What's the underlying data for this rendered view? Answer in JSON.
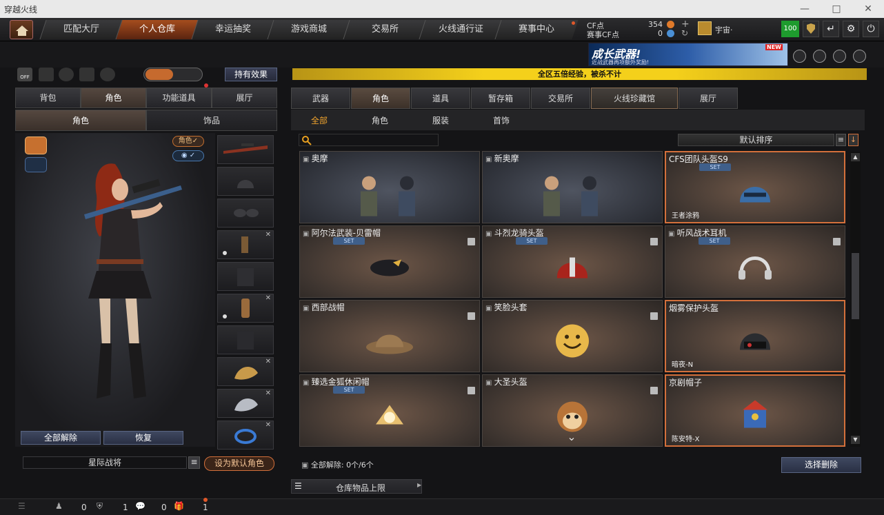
{
  "window": {
    "title": "穿越火线"
  },
  "nav": {
    "tabs": [
      {
        "label": "匹配大厅"
      },
      {
        "label": "个人仓库"
      },
      {
        "label": "幸运抽奖"
      },
      {
        "label": "游戏商城"
      },
      {
        "label": "交易所"
      },
      {
        "label": "火线通行证"
      },
      {
        "label": "赛事中心"
      }
    ],
    "active_index": 1
  },
  "currency": {
    "cf_label": "CF点",
    "cf_value": "354",
    "match_label": "赛事CF点",
    "match_value": "0"
  },
  "user": {
    "name": "宇宙·",
    "level": "100"
  },
  "promo": {
    "title": "成长武器!",
    "subtitle": "近战武器再项额外奖励!",
    "badge": "NEW"
  },
  "notice": {
    "text": "全区五倍经验，被杀不计"
  },
  "left": {
    "main_tabs": [
      {
        "label": "背包"
      },
      {
        "label": "角色"
      },
      {
        "label": "功能道具"
      },
      {
        "label": "展厅"
      }
    ],
    "sub_tabs": [
      {
        "label": "角色"
      },
      {
        "label": "饰品"
      }
    ],
    "view_tags": [
      {
        "label": "角色✓"
      },
      {
        "label": "◉ ✓"
      }
    ],
    "unequip_all": "全部解除",
    "restore": "恢复",
    "char_name": "星际战将",
    "set_default": "设为默认角色"
  },
  "right": {
    "tabs": [
      {
        "label": "武器"
      },
      {
        "label": "角色"
      },
      {
        "label": "道具"
      },
      {
        "label": "暂存箱"
      },
      {
        "label": "交易所"
      },
      {
        "label": "火线珍藏馆"
      },
      {
        "label": "展厅"
      }
    ],
    "subtabs": [
      {
        "label": "全部"
      },
      {
        "label": "角色"
      },
      {
        "label": "服装"
      },
      {
        "label": "首饰"
      }
    ],
    "sort": "默认排序",
    "search_placeholder": "",
    "items": [
      {
        "name": "奥摩",
        "set": "",
        "foot": "",
        "art": "soldiers"
      },
      {
        "name": "新奥摩",
        "set": "",
        "foot": "",
        "art": "soldiers"
      },
      {
        "name": "CFS团队头盔S9",
        "set": "SET",
        "foot": "王者涂鸦",
        "art": "helmet-blue"
      },
      {
        "name": "阿尔法武装-贝雷帽",
        "set": "SET",
        "foot": "",
        "art": "beret"
      },
      {
        "name": "斗烈龙骑头盔",
        "set": "SET",
        "foot": "",
        "art": "dragon-helmet"
      },
      {
        "name": "听风战术耳机",
        "set": "SET",
        "foot": "",
        "art": "headphones"
      },
      {
        "name": "西部战帽",
        "set": "",
        "foot": "",
        "art": "bucket-hat"
      },
      {
        "name": "笑脸头套",
        "set": "",
        "foot": "",
        "art": "smiley"
      },
      {
        "name": "烟雾保护头盔",
        "set": "",
        "foot": "暗夜-N",
        "art": "gas-helmet"
      },
      {
        "name": "臻选金狐休闲帽",
        "set": "SET",
        "foot": "",
        "art": "fox-hat"
      },
      {
        "name": "大圣头盔",
        "set": "",
        "foot": "",
        "art": "monkey"
      },
      {
        "name": "京剧帽子",
        "set": "",
        "foot": "陈安特-X",
        "art": "opera-hat"
      }
    ],
    "unequip_summary": "全部解除: 0个/6个",
    "select_delete": "选择删除",
    "storage_limit": "仓库物品上限"
  },
  "bottom": {
    "count1": "0",
    "count2": "1",
    "count3": "0",
    "count4": "1"
  },
  "colors": {
    "accent": "#d4703b",
    "notice": "#f4d01b",
    "selected_tab": "#a54d1e"
  }
}
